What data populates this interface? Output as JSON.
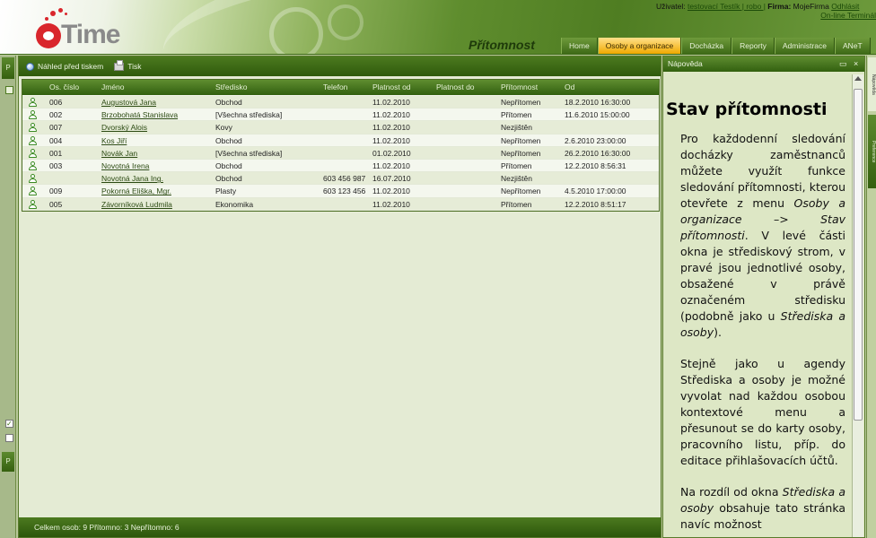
{
  "header": {
    "logo_text": "Time",
    "page_title": "Přítomnost",
    "user_label": "Uživatel:",
    "user_name": "testovací Testík | robo |",
    "firm_label": "Firma:",
    "firm_name": "MojeFirma",
    "logout": "Odhlásit",
    "terminal": "On-line Terminál",
    "nav": [
      "Home",
      "Osoby a organizace",
      "Docházka",
      "Reporty",
      "Administrace",
      "ANeT"
    ],
    "active_nav": "Osoby a organizace"
  },
  "left": {
    "top_tab": "P",
    "mid_tab": "P"
  },
  "toolbar": {
    "preview": "Náhled před tiskem",
    "print": "Tisk"
  },
  "grid": {
    "columns": [
      "Os. číslo",
      "Jméno",
      "Středisko",
      "Telefon",
      "Platnost od",
      "Platnost do",
      "Přítomnost",
      "Od"
    ],
    "rows": [
      [
        "006",
        "Augustová Jana",
        "Obchod",
        "",
        "11.02.2010",
        "",
        "Nepřítomen",
        "18.2.2010 16:30:00"
      ],
      [
        "002",
        "Brzobohatá Stanislava",
        "[Všechna střediska]",
        "",
        "11.02.2010",
        "",
        "Přítomen",
        "11.6.2010 15:00:00"
      ],
      [
        "007",
        "Dvorský Alois",
        "Kovy",
        "",
        "11.02.2010",
        "",
        "Nezjištěn",
        ""
      ],
      [
        "004",
        "Kos Jiří",
        "Obchod",
        "",
        "11.02.2010",
        "",
        "Nepřítomen",
        "2.6.2010 23:00:00"
      ],
      [
        "001",
        "Novák Jan",
        "[Všechna střediska]",
        "",
        "01.02.2010",
        "",
        "Nepřítomen",
        "26.2.2010 16:30:00"
      ],
      [
        "003",
        "Novotná Irena",
        "Obchod",
        "",
        "11.02.2010",
        "",
        "Přítomen",
        "12.2.2010 8:56:31"
      ],
      [
        "",
        "Novotná Jana Ing.",
        "Obchod",
        "603 456 987",
        "16.07.2010",
        "",
        "Nezjištěn",
        ""
      ],
      [
        "009",
        "Pokorná Eliška, Mgr.",
        "Plasty",
        "603 123 456",
        "11.02.2010",
        "",
        "Nepřítomen",
        "4.5.2010 17:00:00"
      ],
      [
        "005",
        "Závorníková Ludmila",
        "Ekonomika",
        "",
        "11.02.2010",
        "",
        "Přítomen",
        "12.2.2010 8:51:17"
      ]
    ]
  },
  "status": "Celkem osob: 9 Přítomno: 3 Nepřítomno: 6",
  "help": {
    "title": "Nápověda",
    "heading": "Stav přítomnosti",
    "p1_a": "Pro každodenní sledování docházky zaměstnanců můžete využít funkce sledování přítomnosti, kterou otevřete z menu ",
    "p1_em1": "Osoby a organizace –> Stav přítomnosti",
    "p1_b": ". V levé části okna je střediskový strom, v pravé jsou jednotlivé osoby, obsažené v právě označeném středisku (podobně jako u ",
    "p1_em2": "Střediska a osoby",
    "p1_c": ").",
    "p2": "Stejně jako u agendy Střediska a osoby je možné vyvolat nad každou osobou kontextové menu a přesunout se do karty osoby, pracovního listu, příp. do editace přihlašovacích účtů.",
    "p3_a": "Na rozdíl od okna ",
    "p3_em": "Střediska a osoby",
    "p3_b": " obsahuje tato stránka navíc možnost"
  },
  "right_strip": {
    "tab1": "Nápověda",
    "tab2": "Preference"
  }
}
